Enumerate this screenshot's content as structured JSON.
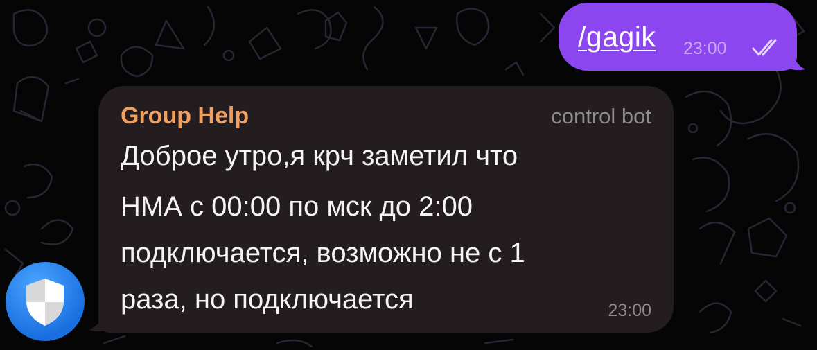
{
  "chat": {
    "outgoing": {
      "text": "/gagik",
      "time": "23:00",
      "status_icon": "double-check-icon"
    },
    "incoming": {
      "sender": "Group Help",
      "badge": "control bot",
      "lines": [
        "Доброе утро,я крч заметил что",
        "НМА с 00:00 по мск до 2:00",
        "подключается, возможно не с 1",
        "раза, но подключается"
      ],
      "time": "23:00",
      "avatar_icon": "shield-icon"
    }
  },
  "colors": {
    "outgoing_bubble": "#8b46f0",
    "incoming_bubble": "#241d1f",
    "sender_name": "#f0a060",
    "avatar": "#1a6fe0",
    "background": "#050505"
  }
}
